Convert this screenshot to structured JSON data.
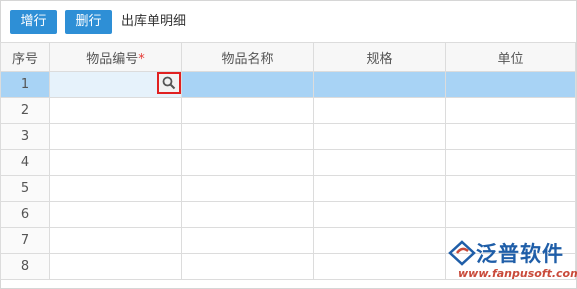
{
  "toolbar": {
    "add_row_label": "增行",
    "delete_row_label": "删行",
    "title": "出库单明细"
  },
  "grid": {
    "columns": {
      "seq": "序号",
      "item_code": "物品编号",
      "item_code_required_mark": "*",
      "item_name": "物品名称",
      "spec": "规格",
      "unit": "单位"
    },
    "rows": [
      "1",
      "2",
      "3",
      "4",
      "5",
      "6",
      "7",
      "8"
    ],
    "selected_row": "1"
  },
  "watermark": {
    "brand_cn": "泛普软件",
    "url": "www.fanpusoft.com"
  },
  "colors": {
    "button": "#2e8fd6",
    "selected_row": "#a8d3f5",
    "required": "#e53935",
    "highlight_border": "#e02020"
  }
}
